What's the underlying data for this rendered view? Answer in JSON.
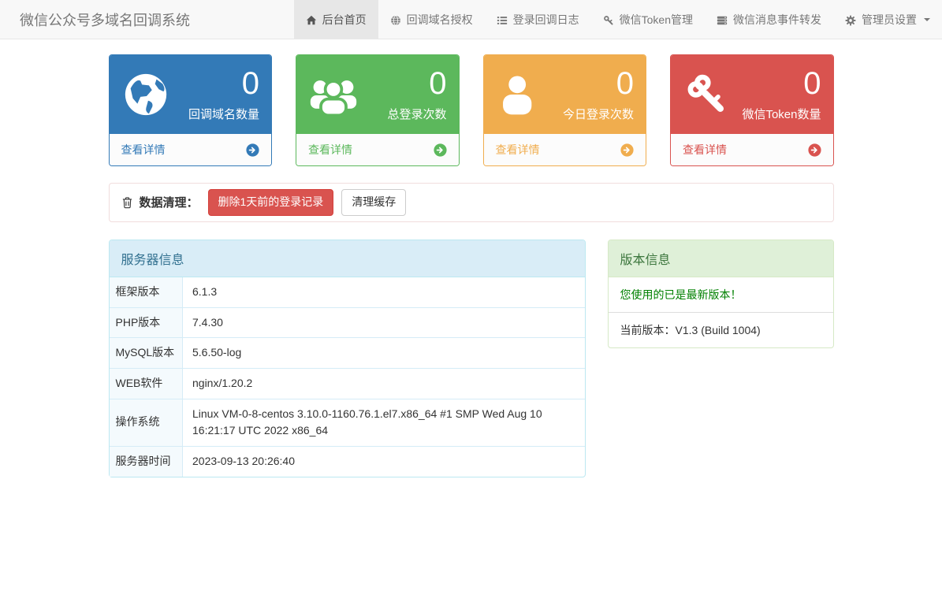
{
  "navbar": {
    "brand": "微信公众号多域名回调系统",
    "items": [
      {
        "label": "后台首页",
        "icon": "home-icon",
        "active": true
      },
      {
        "label": "回调域名授权",
        "icon": "globe-icon",
        "active": false
      },
      {
        "label": "登录回调日志",
        "icon": "list-icon",
        "active": false
      },
      {
        "label": "微信Token管理",
        "icon": "key-icon",
        "active": false
      },
      {
        "label": "微信消息事件转发",
        "icon": "server-icon",
        "active": false
      },
      {
        "label": "管理员设置",
        "icon": "gear-icon",
        "active": false,
        "dropdown": true
      }
    ]
  },
  "stat_cards": [
    {
      "value": "0",
      "label": "回调域名数量",
      "link_label": "查看详情",
      "icon": "globe-icon",
      "color": "#337ab7"
    },
    {
      "value": "0",
      "label": "总登录次数",
      "link_label": "查看详情",
      "icon": "users-icon",
      "color": "#5cb85c"
    },
    {
      "value": "0",
      "label": "今日登录次数",
      "link_label": "查看详情",
      "icon": "user-icon",
      "color": "#f0ad4e"
    },
    {
      "value": "0",
      "label": "微信Token数量",
      "link_label": "查看详情",
      "icon": "key-icon",
      "color": "#d9534f"
    }
  ],
  "cleanup": {
    "icon": "trash-icon",
    "label": "数据清理：",
    "delete_button_label": "删除1天前的登录记录",
    "clear_cache_button_label": "清理缓存"
  },
  "server_info": {
    "title": "服务器信息",
    "rows": [
      {
        "label": "框架版本",
        "value": "6.1.3"
      },
      {
        "label": "PHP版本",
        "value": "7.4.30"
      },
      {
        "label": "MySQL版本",
        "value": "5.6.50-log"
      },
      {
        "label": "WEB软件",
        "value": "nginx/1.20.2"
      },
      {
        "label": "操作系统",
        "value": "Linux VM-0-8-centos 3.10.0-1160.76.1.el7.x86_64 #1 SMP Wed Aug 10 16:21:17 UTC 2022 x86_64"
      },
      {
        "label": "服务器时间",
        "value": "2023-09-13 20:26:40"
      }
    ]
  },
  "version_info": {
    "title": "版本信息",
    "status_message": "您使用的已是最新版本！",
    "current_version": "当前版本：V1.3 (Build 1004)"
  },
  "colors": {
    "primary_blue": "#337ab7",
    "success_green": "#5cb85c",
    "warning_orange": "#f0ad4e",
    "danger_red": "#d9534f",
    "navbar_bg": "#f8f8f8",
    "navbar_active_bg": "#e7e7e7",
    "info_header_bg": "#d9edf7",
    "info_header_text": "#31708f",
    "version_header_bg": "#dff0d8",
    "version_header_text": "#3c763d",
    "latest_version_text": "#008000"
  }
}
